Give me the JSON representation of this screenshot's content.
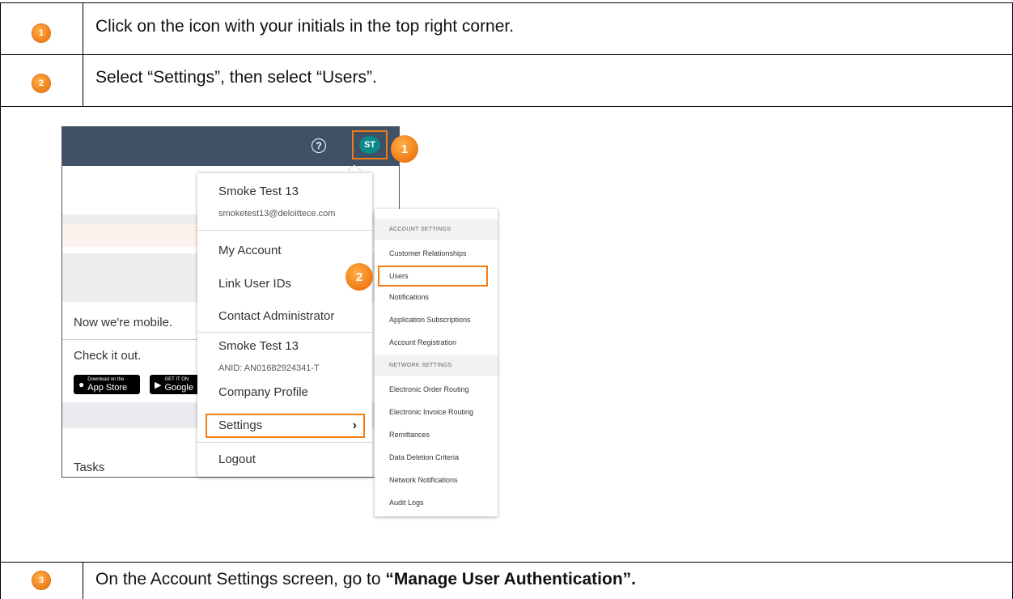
{
  "steps": [
    {
      "number": "1",
      "text": "Click on the icon with your initials in the top right corner."
    },
    {
      "number": "2",
      "text": "Select “Settings”, then select “Users”."
    },
    {
      "number": "3",
      "text_prefix": "On the Account Settings screen, go to ",
      "text_bold": "“Manage User Authentication”."
    }
  ],
  "screenshot": {
    "help_glyph": "?",
    "avatar_initials": "ST",
    "callout_1": "1",
    "callout_2": "2",
    "background": {
      "mobile_text": "Now we're mobile.",
      "check_text": "Check it out.",
      "app_store_small": "Download on the",
      "app_store": "App Store",
      "google_small": "GET IT ON",
      "google": "Google",
      "tasks": "Tasks"
    },
    "menu": {
      "user_name": "Smoke Test 13",
      "user_email": "smoketest13@deloittece.com",
      "my_account": "My Account",
      "link_user_ids": "Link User IDs",
      "contact_admin": "Contact Administrator",
      "company_name": "Smoke Test 13",
      "anid": "ANID: AN01682924341-T",
      "company_profile": "Company Profile",
      "settings": "Settings",
      "logout": "Logout"
    },
    "submenu": {
      "account_settings_header": "ACCOUNT SETTINGS",
      "account_items": [
        "Customer Relationships",
        "Users",
        "Notifications",
        "Application Subscriptions",
        "Account Registration"
      ],
      "network_settings_header": "NETWORK SETTINGS",
      "network_items": [
        "Electronic Order Routing",
        "Electronic Invoice Routing",
        "Remittances",
        "Data Deletion Criteria",
        "Network Notifications",
        "Audit Logs"
      ]
    }
  }
}
